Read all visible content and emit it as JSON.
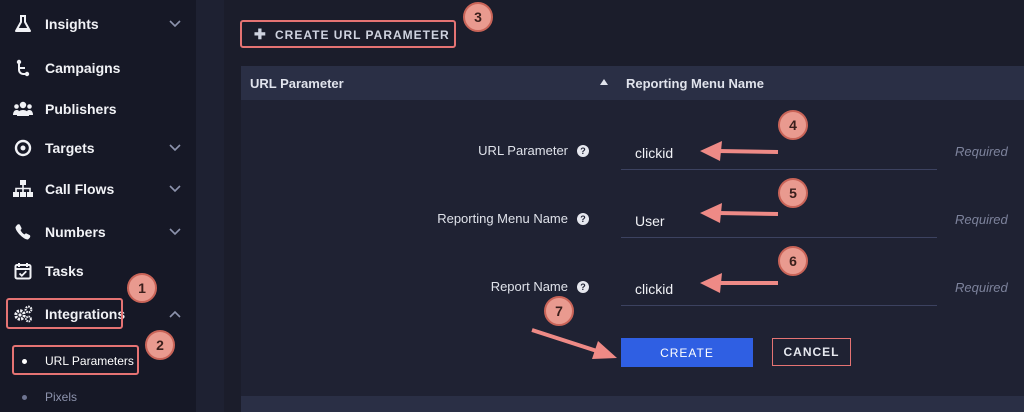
{
  "sidebar": {
    "items": [
      {
        "label": "Insights",
        "icon": "flask-icon",
        "chevron": "down"
      },
      {
        "label": "Campaigns",
        "icon": "campaign-icon",
        "chevron": ""
      },
      {
        "label": "Publishers",
        "icon": "users-icon",
        "chevron": ""
      },
      {
        "label": "Targets",
        "icon": "target-icon",
        "chevron": "down"
      },
      {
        "label": "Call Flows",
        "icon": "sitemap-icon",
        "chevron": "down"
      },
      {
        "label": "Numbers",
        "icon": "phone-icon",
        "chevron": "down"
      },
      {
        "label": "Tasks",
        "icon": "calendar-check-icon",
        "chevron": ""
      },
      {
        "label": "Integrations",
        "icon": "cogs-icon",
        "chevron": "up"
      }
    ],
    "sub_items": [
      {
        "label": "URL Parameters",
        "active": true
      },
      {
        "label": "Pixels",
        "active": false
      }
    ]
  },
  "toolbar": {
    "create_url_label": "CREATE URL PARAMETER"
  },
  "table": {
    "columns": [
      "URL Parameter",
      "Reporting Menu Name"
    ]
  },
  "form": {
    "fields": [
      {
        "label": "URL Parameter",
        "value": "clickid",
        "hint": "Required"
      },
      {
        "label": "Reporting Menu Name",
        "value": "User",
        "hint": "Required"
      },
      {
        "label": "Report Name",
        "value": "clickid",
        "hint": "Required"
      }
    ],
    "create_label": "CREATE",
    "cancel_label": "CANCEL"
  },
  "callouts": [
    "1",
    "2",
    "3",
    "4",
    "5",
    "6",
    "7"
  ],
  "colors": {
    "accent": "#2f5fe3",
    "highlight": "#e57373",
    "callout_fill": "#e99a8f"
  }
}
